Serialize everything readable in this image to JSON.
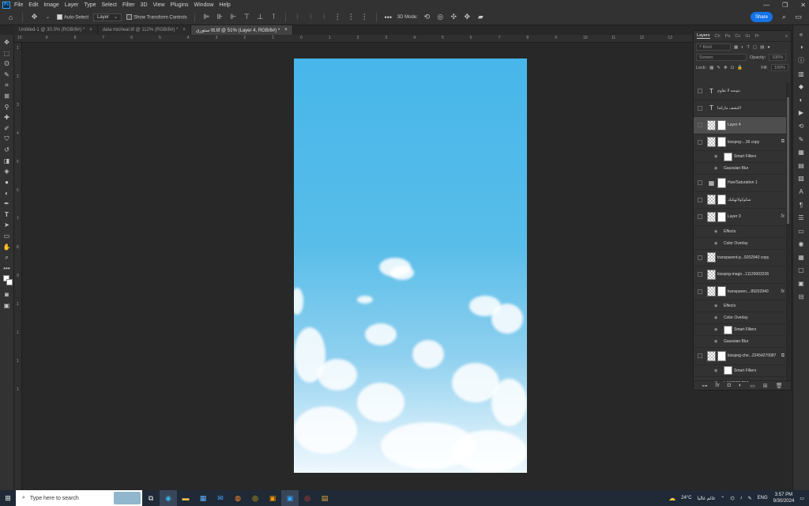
{
  "app": {
    "logo": "Ps"
  },
  "menu": [
    "File",
    "Edit",
    "Image",
    "Layer",
    "Type",
    "Select",
    "Filter",
    "3D",
    "View",
    "Plugins",
    "Window",
    "Help"
  ],
  "options": {
    "auto_select_label": "Auto-Select",
    "auto_select_target": "Layer",
    "transform_label": "Show Transform Controls",
    "mode3d_label": "3D Mode:",
    "share_label": "Share"
  },
  "tabs": [
    {
      "label": "Untitled-1 @ 30.3% (RGB/8#) *",
      "close": "×"
    },
    {
      "label": "data micheal.tif @ 112% (RGB/8#) *",
      "close": "×"
    },
    {
      "label": "ستوري ttt.tif @ 51% (Layer 4, RGB/8#) *",
      "close": "×"
    }
  ],
  "ruler": {
    "h": [
      "10",
      "9",
      "8",
      "7",
      "6",
      "5",
      "4",
      "3",
      "2",
      "1",
      "0",
      "1",
      "2",
      "3",
      "4",
      "5",
      "6",
      "7",
      "8",
      "9",
      "10",
      "11",
      "12",
      "13",
      "14"
    ],
    "v": [
      "1",
      "2",
      "3",
      "4",
      "5",
      "6",
      "7",
      "8",
      "9",
      "1",
      "1",
      "1",
      "1"
    ]
  },
  "layers_panel": {
    "tabs": [
      "Layers",
      "Ch",
      "Pa",
      "Co",
      "Gr",
      "Pr"
    ],
    "active_tab": "Layers",
    "filter_kind": "Kind",
    "blend_mode": "Screen",
    "opacity_label": "Opacity:",
    "opacity_value": "100%",
    "lock_label": "Lock:",
    "fill_label": "Fill:",
    "fill_value": "100%",
    "layers": [
      {
        "name": "بتوسه لا تقاوم",
        "kind": "type"
      },
      {
        "name": "اكتشف ماركتنا",
        "kind": "type"
      },
      {
        "name": "Layer 4",
        "kind": "pixel",
        "selected": true
      },
      {
        "name": "kisspng-...36 copy",
        "kind": "smart"
      },
      {
        "name": "Smart Filters",
        "kind": "sub"
      },
      {
        "name": "Gaussian Blur",
        "kind": "sub"
      },
      {
        "name": "Hue/Saturation 1",
        "kind": "adjust"
      },
      {
        "name": "شكوكولاتهكيك",
        "kind": "pixel"
      },
      {
        "name": "Layer 3",
        "kind": "pixel",
        "fx": "fx"
      },
      {
        "name": "Effects",
        "kind": "sub"
      },
      {
        "name": "Color Overlay",
        "kind": "sub"
      },
      {
        "name": "transparent-p...9202940 copy",
        "kind": "pixel"
      },
      {
        "name": "kisspng-magn...11129003236",
        "kind": "pixel"
      },
      {
        "name": "transparen....89202940",
        "kind": "smart",
        "fx": "fx"
      },
      {
        "name": "Effects",
        "kind": "sub"
      },
      {
        "name": "Color Overlay",
        "kind": "sub"
      },
      {
        "name": "Smart Filters",
        "kind": "sub"
      },
      {
        "name": "Gaussian Blur",
        "kind": "sub"
      },
      {
        "name": "kisspng-che...22454270087",
        "kind": "smart"
      },
      {
        "name": "Smart Filters",
        "kind": "sub"
      },
      {
        "name": "Gaussian Blur",
        "kind": "sub"
      }
    ]
  },
  "taskbar": {
    "search_placeholder": "Type here to search",
    "weather": "24°C",
    "weather_desc": "غائم غالبا",
    "lang": "ENG",
    "time": "3:57 PM",
    "date": "9/30/2024"
  },
  "colors": {
    "accent": "#1473e6",
    "panel": "#323232",
    "bg": "#282828",
    "sky_top": "#47b6ea"
  }
}
